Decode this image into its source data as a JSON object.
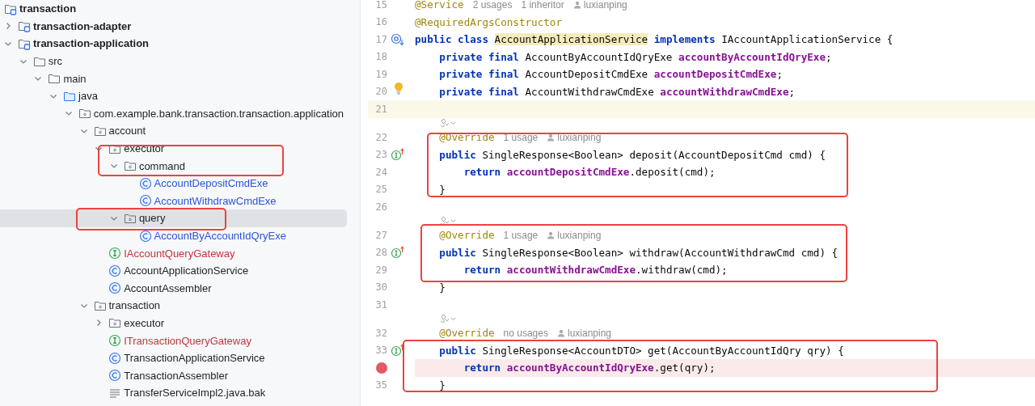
{
  "project_tree": [
    {
      "label": "transaction",
      "kind": "module",
      "selected": false,
      "children": [
        {
          "label": "transaction-adapter",
          "kind": "module",
          "expanded": false,
          "selected": false
        },
        {
          "label": "transaction-application",
          "kind": "module",
          "expanded": true,
          "selected": false,
          "children": [
            {
              "label": "src",
              "kind": "folder",
              "expanded": true,
              "selected": false,
              "children": [
                {
                  "label": "main",
                  "kind": "folder",
                  "expanded": true,
                  "selected": false,
                  "children": [
                    {
                      "label": "java",
                      "kind": "source-folder",
                      "expanded": true,
                      "selected": false,
                      "children": [
                        {
                          "label": "com.example.bank.transaction.transaction.application",
                          "kind": "package",
                          "expanded": true,
                          "selected": false,
                          "children": [
                            {
                              "label": "account",
                              "kind": "package",
                              "expanded": true,
                              "selected": false,
                              "children": [
                                {
                                  "label": "executor",
                                  "kind": "package",
                                  "expanded": true,
                                  "selected": false,
                                  "children": [
                                    {
                                      "label": "command",
                                      "kind": "package",
                                      "expanded": true,
                                      "selected": false,
                                      "children": [
                                        {
                                          "label": "AccountDepositCmdExe",
                                          "kind": "class",
                                          "color": "#2a55d6",
                                          "selected": false
                                        },
                                        {
                                          "label": "AccountWithdrawCmdExe",
                                          "kind": "class",
                                          "color": "#2a55d6",
                                          "selected": false
                                        }
                                      ]
                                    },
                                    {
                                      "label": "query",
                                      "kind": "package",
                                      "expanded": true,
                                      "selected": true,
                                      "children": [
                                        {
                                          "label": "AccountByAccountIdQryExe",
                                          "kind": "class",
                                          "color": "#2a55d6",
                                          "selected": false
                                        }
                                      ]
                                    }
                                  ]
                                },
                                {
                                  "label": "IAccountQueryGateway",
                                  "kind": "interface",
                                  "color": "#c7323e",
                                  "selected": false
                                },
                                {
                                  "label": "AccountApplicationService",
                                  "kind": "class",
                                  "selected": false
                                },
                                {
                                  "label": "AccountAssembler",
                                  "kind": "class",
                                  "selected": false
                                }
                              ]
                            },
                            {
                              "label": "transaction",
                              "kind": "package",
                              "expanded": true,
                              "selected": false,
                              "children": [
                                {
                                  "label": "executor",
                                  "kind": "package",
                                  "expanded": false,
                                  "selected": false
                                },
                                {
                                  "label": "ITransactionQueryGateway",
                                  "kind": "interface",
                                  "color": "#c7323e",
                                  "selected": false
                                },
                                {
                                  "label": "TransactionApplicationService",
                                  "kind": "class",
                                  "selected": false
                                },
                                {
                                  "label": "TransactionAssembler",
                                  "kind": "class",
                                  "selected": false
                                },
                                {
                                  "label": "TransferServiceImpl2.java.bak",
                                  "kind": "file",
                                  "selected": false
                                }
                              ]
                            }
                          ]
                        }
                      ]
                    }
                  ]
                }
              ]
            }
          ]
        }
      ]
    }
  ],
  "editor_lines": [
    {
      "kind": "code",
      "number": "15",
      "tokens": [
        {
          "kind": "annotation",
          "text": "@Service"
        }
      ],
      "hints": [
        {
          "kind": "usage",
          "text": "2 usages"
        },
        {
          "kind": "usage",
          "text": "1 inheritor"
        },
        {
          "kind": "author",
          "text": "luxianping"
        }
      ]
    },
    {
      "kind": "code",
      "number": "16",
      "tokens": [
        {
          "kind": "annotation",
          "text": "@RequiredArgsConstructor"
        }
      ]
    },
    {
      "kind": "code",
      "number": "17",
      "implemented": true,
      "tokens": [
        {
          "kind": "keyword",
          "text": "public class "
        },
        {
          "kind": "highlight",
          "text": "AccountApplicationService"
        },
        {
          "kind": "keyword",
          "text": " implements "
        },
        {
          "kind": "plain",
          "text": "IAccountApplicationService {"
        }
      ]
    },
    {
      "kind": "code",
      "number": "18",
      "tokens": [
        {
          "kind": "keyword",
          "text": "    private final "
        },
        {
          "kind": "plain",
          "text": "AccountByAccountIdQryExe "
        },
        {
          "kind": "field",
          "text": "accountByAccountIdQryExe"
        },
        {
          "kind": "plain",
          "text": ";"
        }
      ]
    },
    {
      "kind": "code",
      "number": "19",
      "tokens": [
        {
          "kind": "keyword",
          "text": "    private final "
        },
        {
          "kind": "plain",
          "text": "AccountDepositCmdExe "
        },
        {
          "kind": "field",
          "text": "accountDepositCmdExe"
        },
        {
          "kind": "plain",
          "text": ";"
        }
      ]
    },
    {
      "kind": "code",
      "number": "20",
      "bulb": true,
      "tokens": [
        {
          "kind": "keyword",
          "text": "    private final "
        },
        {
          "kind": "plain",
          "text": "AccountWithdrawCmdExe "
        },
        {
          "kind": "field",
          "text": "accountWithdrawCmdExe"
        },
        {
          "kind": "plain",
          "text": ";"
        }
      ]
    },
    {
      "kind": "code",
      "number": "21",
      "current": true
    },
    {
      "kind": "vision"
    },
    {
      "kind": "code",
      "number": "22",
      "tokens": [
        {
          "kind": "annotation",
          "text": "    @Override"
        }
      ],
      "hints": [
        {
          "kind": "usage",
          "text": "1 usage"
        },
        {
          "kind": "author",
          "text": "luxianping"
        }
      ]
    },
    {
      "kind": "code",
      "number": "23",
      "overrides": true,
      "tokens": [
        {
          "kind": "keyword",
          "text": "    public "
        },
        {
          "kind": "plain",
          "text": "SingleResponse<Boolean> deposit(AccountDepositCmd cmd) {"
        }
      ]
    },
    {
      "kind": "code",
      "number": "24",
      "tokens": [
        {
          "kind": "keyword",
          "text": "        return "
        },
        {
          "kind": "field",
          "text": "accountDepositCmdExe"
        },
        {
          "kind": "plain",
          "text": ".deposit(cmd);"
        }
      ]
    },
    {
      "kind": "code",
      "number": "25",
      "tokens": [
        {
          "kind": "plain",
          "text": "    }"
        }
      ]
    },
    {
      "kind": "code",
      "number": "26"
    },
    {
      "kind": "vision"
    },
    {
      "kind": "code",
      "number": "27",
      "tokens": [
        {
          "kind": "annotation",
          "text": "    @Override"
        }
      ],
      "hints": [
        {
          "kind": "usage",
          "text": "1 usage"
        },
        {
          "kind": "author",
          "text": "luxianping"
        }
      ]
    },
    {
      "kind": "code",
      "number": "28",
      "overrides": true,
      "tokens": [
        {
          "kind": "keyword",
          "text": "    public "
        },
        {
          "kind": "plain",
          "text": "SingleResponse<Boolean> withdraw(AccountWithdrawCmd cmd) {"
        }
      ]
    },
    {
      "kind": "code",
      "number": "29",
      "tokens": [
        {
          "kind": "keyword",
          "text": "        return "
        },
        {
          "kind": "field",
          "text": "accountWithdrawCmdExe"
        },
        {
          "kind": "plain",
          "text": ".withdraw(cmd);"
        }
      ]
    },
    {
      "kind": "code",
      "number": "30",
      "tokens": [
        {
          "kind": "plain",
          "text": "    }"
        }
      ]
    },
    {
      "kind": "code",
      "number": "31"
    },
    {
      "kind": "vision"
    },
    {
      "kind": "code",
      "number": "32",
      "tokens": [
        {
          "kind": "annotation",
          "text": "    @Override"
        }
      ],
      "hints": [
        {
          "kind": "usage",
          "text": "no usages"
        },
        {
          "kind": "author",
          "text": "luxianping"
        }
      ]
    },
    {
      "kind": "code",
      "number": "33",
      "overrides": true,
      "tokens": [
        {
          "kind": "keyword",
          "text": "    public "
        },
        {
          "kind": "plain",
          "text": "SingleResponse<AccountDTO> get(AccountByAccountIdQry qry) {"
        }
      ]
    },
    {
      "kind": "code",
      "breakpoint": true,
      "tokens": [
        {
          "kind": "keyword",
          "text": "        return "
        },
        {
          "kind": "field",
          "text": "accountByAccountIdQryExe"
        },
        {
          "kind": "plain",
          "text": ".get(qry);"
        }
      ]
    },
    {
      "kind": "code",
      "number": "35",
      "tokens": [
        {
          "kind": "plain",
          "text": "    }"
        }
      ]
    }
  ]
}
